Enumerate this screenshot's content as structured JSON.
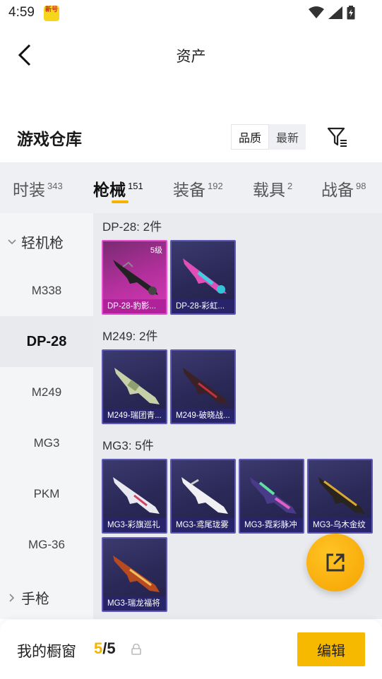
{
  "status_bar": {
    "time": "4:59",
    "app_badge": "新号"
  },
  "header": {
    "title": "资产"
  },
  "warehouse": {
    "title": "游戏仓库",
    "sort_options": [
      "品质",
      "最新"
    ],
    "active_sort": 0
  },
  "tabs": [
    {
      "label": "时装",
      "count": "343"
    },
    {
      "label": "枪械",
      "count": "151"
    },
    {
      "label": "装备",
      "count": "192"
    },
    {
      "label": "载具",
      "count": "2"
    },
    {
      "label": "战备",
      "count": "98"
    }
  ],
  "active_tab": 1,
  "side_nav": {
    "group_open": "轻机枪",
    "items": [
      "M338",
      "DP-28",
      "M249",
      "MG3",
      "PKM",
      "MG-36"
    ],
    "active_item": "DP-28",
    "group_closed": "手枪"
  },
  "groups": [
    {
      "title": "DP-28: 2件",
      "items": [
        {
          "name": "DP-28-豹影...",
          "level": "5级",
          "rarity": "legendary"
        },
        {
          "name": "DP-28-彩虹...",
          "rarity": "epic"
        }
      ]
    },
    {
      "title": "M249: 2件",
      "items": [
        {
          "name": "M249-瑞团青...",
          "rarity": "epic"
        },
        {
          "name": "M249-破晓战...",
          "rarity": "epic"
        }
      ]
    },
    {
      "title": "MG3: 5件",
      "items": [
        {
          "name": "MG3-彩旗巡礼",
          "rarity": "epic"
        },
        {
          "name": "MG3-鸢尾珑雾",
          "rarity": "epic"
        },
        {
          "name": "MG3-霓彩脉冲",
          "rarity": "epic"
        },
        {
          "name": "MG3-乌木金纹",
          "rarity": "epic"
        },
        {
          "name": "MG3-瑞龙福将",
          "rarity": "epic"
        }
      ]
    }
  ],
  "bottom_bar": {
    "label": "我的橱窗",
    "current": "5",
    "total": "/5",
    "edit_label": "编辑"
  },
  "colors": {
    "accent": "#f5b300",
    "epic": "#5e59b8",
    "legendary": "#d53ab6"
  }
}
